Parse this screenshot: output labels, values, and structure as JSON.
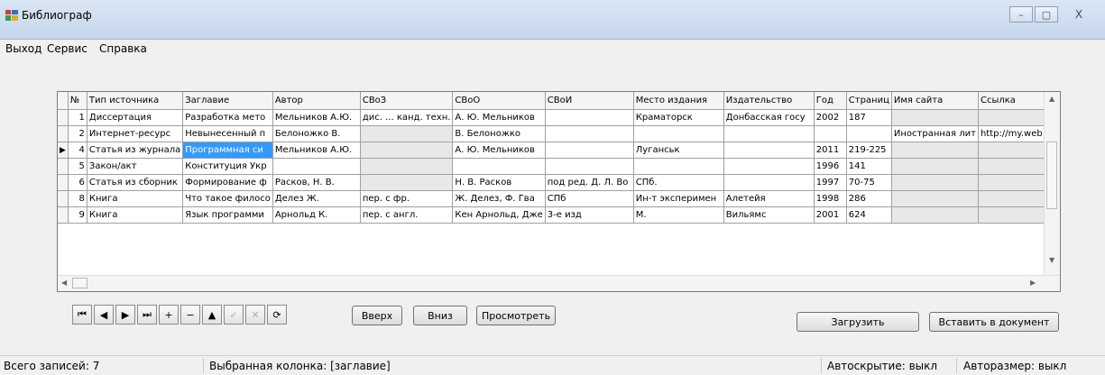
{
  "window": {
    "title": "Библиограф",
    "controls": [
      "–",
      "▢",
      "X"
    ]
  },
  "menu": [
    "Выход",
    "Сервис",
    "Справка"
  ],
  "grid": {
    "columns": [
      "№",
      "Тип источника",
      "Заглавие",
      "Автор",
      "СВоЗ",
      "СВоО",
      "СВоИ",
      "Место издания",
      "Издательство",
      "Год",
      "Страниц",
      "Имя сайта",
      "Ссылка"
    ],
    "rows": [
      [
        "1",
        "Диссертация",
        "Разработка мето",
        "Мельников А.Ю.",
        "дис. ... канд. техн.",
        "А. Ю. Мельников",
        "",
        "Краматорск",
        "Донбасская госу",
        "2002",
        "187",
        "",
        ""
      ],
      [
        "2",
        "Интернет-ресурс",
        "Невынесенный п",
        "Белоножко В.",
        "",
        "В. Белоножко",
        "",
        "",
        "",
        "",
        "",
        "Иностранная лит",
        "http://my.web"
      ],
      [
        "4",
        "Статья из журнала",
        "Программная си",
        "Мельников А.Ю.",
        "",
        "А. Ю. Мельников",
        "",
        "Луганськ",
        "",
        "2011",
        "219-225",
        "",
        ""
      ],
      [
        "5",
        "Закон/акт",
        "Конституция Укр",
        "",
        "",
        "",
        "",
        "",
        "",
        "1996",
        "141",
        "",
        ""
      ],
      [
        "6",
        "Статья из сборник",
        "Формирование ф",
        "Расков, Н. В.",
        "",
        "Н. В. Расков",
        "под ред. Д. Л. Во",
        "СПб.",
        "",
        "1997",
        "70-75",
        "",
        ""
      ],
      [
        "8",
        "Книга",
        "Что такое филосо",
        "Делез Ж.",
        "пер. с фр.",
        "Ж. Делез, Ф. Гва",
        "СПб",
        "Ин-т эксперимен",
        "Алетейя",
        "1998",
        "286",
        "",
        ""
      ],
      [
        "9",
        "Книга",
        "Язык программи",
        "Арнольд К.",
        "пер. с англ.",
        "Кен Арнольд, Дже",
        "3-е изд",
        "М.",
        "Вильямс",
        "2001",
        "624",
        "",
        ""
      ]
    ],
    "current_row_index": 2,
    "selected_cell_column": 2
  },
  "toolbar": {
    "nav_icons": [
      "⏮",
      "◀",
      "▶",
      "⏭",
      "+",
      "−",
      "▲",
      "✓",
      "✕",
      "⟳"
    ],
    "up_label": "Вверх",
    "down_label": "Вниз",
    "view_label": "Просмотреть",
    "load_label": "Загрузить",
    "insert_label": "Вставить в документ"
  },
  "status": {
    "records": "Всего записей: 7",
    "column": "Выбранная колонка: [заглавие]",
    "autohide": "Автоскрытие: выкл",
    "autosize": "Авторазмер: выкл"
  },
  "colors": {
    "selection": "#3399ff",
    "grid_line": "#a0a0a0",
    "disabled_cell": "#e8e8e8"
  }
}
